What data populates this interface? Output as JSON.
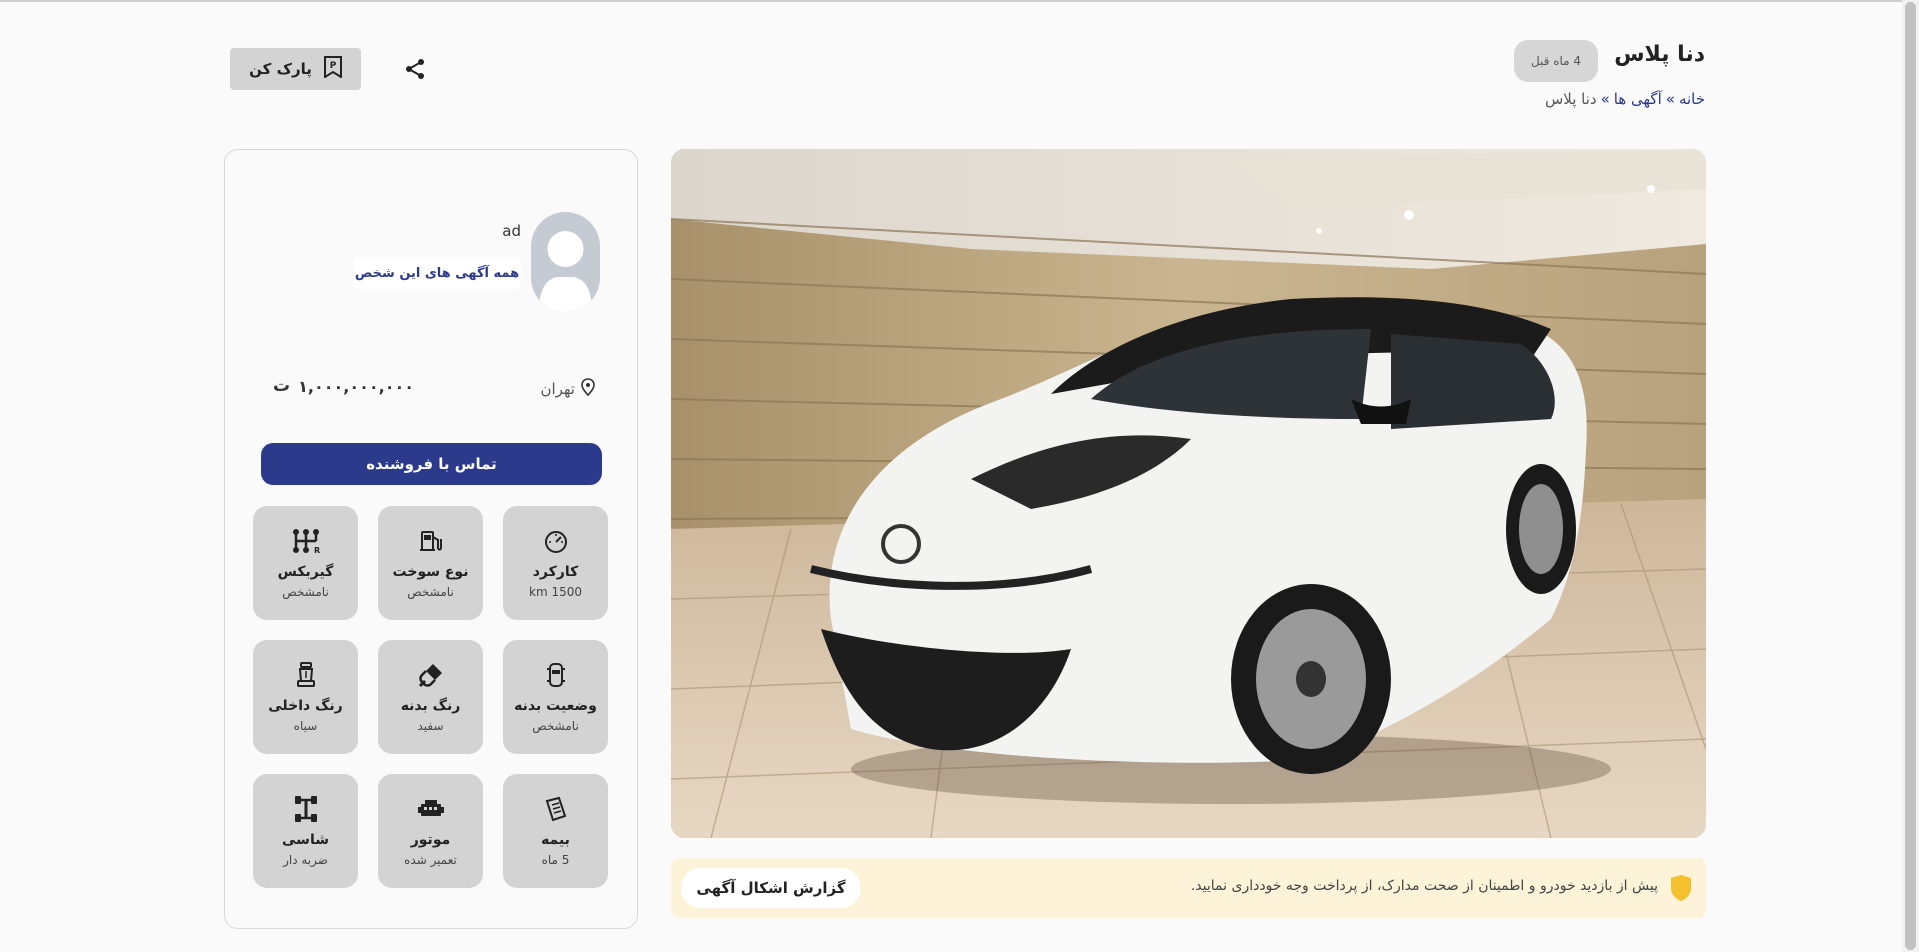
{
  "header": {
    "title": "دنا پلاس",
    "age_badge": "4 ماه قبل",
    "breadcrumb": {
      "home": "خانه",
      "sep1": "»",
      "ads": "آگهی ها",
      "sep2": "»",
      "current": "دنا پلاس"
    },
    "park_label": "پارک کن"
  },
  "notice": {
    "text": "پیش از بازدید خودرو و اطمینان از صحت مدارک، از پرداخت وجه خودداری نمایید.",
    "report_label": "گزارش اشکال آگهی"
  },
  "seller": {
    "name": "ad",
    "all_ads_label": "همه آگهی های این شخص",
    "location": "تهران",
    "price": "۱,۰۰۰,۰۰۰,۰۰۰",
    "currency": "ت",
    "contact_label": "تماس با فروشنده"
  },
  "specs": [
    {
      "label": "کارکرد",
      "value": "km 1500",
      "icon": "speedometer-icon"
    },
    {
      "label": "نوع سوخت",
      "value": "نامشخص",
      "icon": "fuel-pump-icon"
    },
    {
      "label": "گیربکس",
      "value": "نامشخص",
      "icon": "gearbox-icon"
    },
    {
      "label": "وضعیت بدنه",
      "value": "نامشخص",
      "icon": "car-body-icon"
    },
    {
      "label": "رنگ بدنه",
      "value": "سفید",
      "icon": "paint-brush-icon"
    },
    {
      "label": "رنگ داخلی",
      "value": "سیاه",
      "icon": "car-seat-icon"
    },
    {
      "label": "بیمه",
      "value": "5 ماه",
      "icon": "insurance-document-icon"
    },
    {
      "label": "موتور",
      "value": "تعمیر شده",
      "icon": "engine-icon"
    },
    {
      "label": "شاسی",
      "value": "ضربه دار",
      "icon": "chassis-icon"
    }
  ],
  "colors": {
    "accent": "#2c3a8c",
    "tile": "#d3d3d3",
    "notice_bg": "#fdf3d8",
    "shield": "#f5c02e"
  }
}
